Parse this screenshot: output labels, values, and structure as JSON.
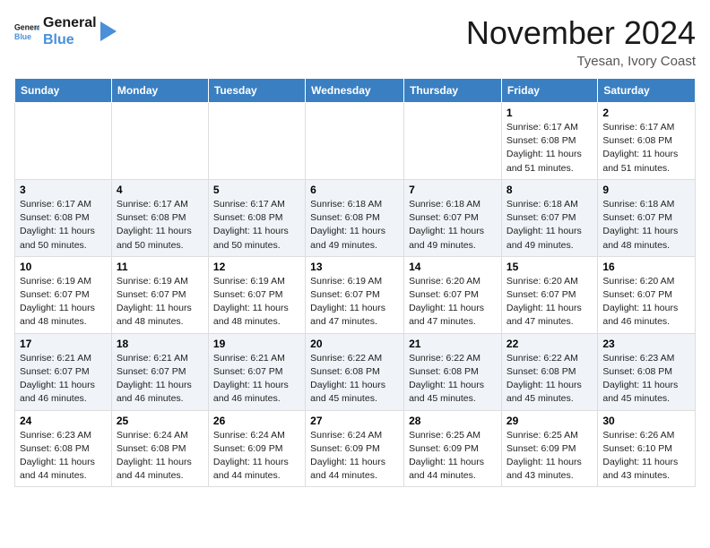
{
  "header": {
    "logo_line1": "General",
    "logo_line2": "Blue",
    "month": "November 2024",
    "location": "Tyesan, Ivory Coast"
  },
  "weekdays": [
    "Sunday",
    "Monday",
    "Tuesday",
    "Wednesday",
    "Thursday",
    "Friday",
    "Saturday"
  ],
  "weeks": [
    [
      {
        "day": "",
        "info": ""
      },
      {
        "day": "",
        "info": ""
      },
      {
        "day": "",
        "info": ""
      },
      {
        "day": "",
        "info": ""
      },
      {
        "day": "",
        "info": ""
      },
      {
        "day": "1",
        "info": "Sunrise: 6:17 AM\nSunset: 6:08 PM\nDaylight: 11 hours\nand 51 minutes."
      },
      {
        "day": "2",
        "info": "Sunrise: 6:17 AM\nSunset: 6:08 PM\nDaylight: 11 hours\nand 51 minutes."
      }
    ],
    [
      {
        "day": "3",
        "info": "Sunrise: 6:17 AM\nSunset: 6:08 PM\nDaylight: 11 hours\nand 50 minutes."
      },
      {
        "day": "4",
        "info": "Sunrise: 6:17 AM\nSunset: 6:08 PM\nDaylight: 11 hours\nand 50 minutes."
      },
      {
        "day": "5",
        "info": "Sunrise: 6:17 AM\nSunset: 6:08 PM\nDaylight: 11 hours\nand 50 minutes."
      },
      {
        "day": "6",
        "info": "Sunrise: 6:18 AM\nSunset: 6:08 PM\nDaylight: 11 hours\nand 49 minutes."
      },
      {
        "day": "7",
        "info": "Sunrise: 6:18 AM\nSunset: 6:07 PM\nDaylight: 11 hours\nand 49 minutes."
      },
      {
        "day": "8",
        "info": "Sunrise: 6:18 AM\nSunset: 6:07 PM\nDaylight: 11 hours\nand 49 minutes."
      },
      {
        "day": "9",
        "info": "Sunrise: 6:18 AM\nSunset: 6:07 PM\nDaylight: 11 hours\nand 48 minutes."
      }
    ],
    [
      {
        "day": "10",
        "info": "Sunrise: 6:19 AM\nSunset: 6:07 PM\nDaylight: 11 hours\nand 48 minutes."
      },
      {
        "day": "11",
        "info": "Sunrise: 6:19 AM\nSunset: 6:07 PM\nDaylight: 11 hours\nand 48 minutes."
      },
      {
        "day": "12",
        "info": "Sunrise: 6:19 AM\nSunset: 6:07 PM\nDaylight: 11 hours\nand 48 minutes."
      },
      {
        "day": "13",
        "info": "Sunrise: 6:19 AM\nSunset: 6:07 PM\nDaylight: 11 hours\nand 47 minutes."
      },
      {
        "day": "14",
        "info": "Sunrise: 6:20 AM\nSunset: 6:07 PM\nDaylight: 11 hours\nand 47 minutes."
      },
      {
        "day": "15",
        "info": "Sunrise: 6:20 AM\nSunset: 6:07 PM\nDaylight: 11 hours\nand 47 minutes."
      },
      {
        "day": "16",
        "info": "Sunrise: 6:20 AM\nSunset: 6:07 PM\nDaylight: 11 hours\nand 46 minutes."
      }
    ],
    [
      {
        "day": "17",
        "info": "Sunrise: 6:21 AM\nSunset: 6:07 PM\nDaylight: 11 hours\nand 46 minutes."
      },
      {
        "day": "18",
        "info": "Sunrise: 6:21 AM\nSunset: 6:07 PM\nDaylight: 11 hours\nand 46 minutes."
      },
      {
        "day": "19",
        "info": "Sunrise: 6:21 AM\nSunset: 6:07 PM\nDaylight: 11 hours\nand 46 minutes."
      },
      {
        "day": "20",
        "info": "Sunrise: 6:22 AM\nSunset: 6:08 PM\nDaylight: 11 hours\nand 45 minutes."
      },
      {
        "day": "21",
        "info": "Sunrise: 6:22 AM\nSunset: 6:08 PM\nDaylight: 11 hours\nand 45 minutes."
      },
      {
        "day": "22",
        "info": "Sunrise: 6:22 AM\nSunset: 6:08 PM\nDaylight: 11 hours\nand 45 minutes."
      },
      {
        "day": "23",
        "info": "Sunrise: 6:23 AM\nSunset: 6:08 PM\nDaylight: 11 hours\nand 45 minutes."
      }
    ],
    [
      {
        "day": "24",
        "info": "Sunrise: 6:23 AM\nSunset: 6:08 PM\nDaylight: 11 hours\nand 44 minutes."
      },
      {
        "day": "25",
        "info": "Sunrise: 6:24 AM\nSunset: 6:08 PM\nDaylight: 11 hours\nand 44 minutes."
      },
      {
        "day": "26",
        "info": "Sunrise: 6:24 AM\nSunset: 6:09 PM\nDaylight: 11 hours\nand 44 minutes."
      },
      {
        "day": "27",
        "info": "Sunrise: 6:24 AM\nSunset: 6:09 PM\nDaylight: 11 hours\nand 44 minutes."
      },
      {
        "day": "28",
        "info": "Sunrise: 6:25 AM\nSunset: 6:09 PM\nDaylight: 11 hours\nand 44 minutes."
      },
      {
        "day": "29",
        "info": "Sunrise: 6:25 AM\nSunset: 6:09 PM\nDaylight: 11 hours\nand 43 minutes."
      },
      {
        "day": "30",
        "info": "Sunrise: 6:26 AM\nSunset: 6:10 PM\nDaylight: 11 hours\nand 43 minutes."
      }
    ]
  ]
}
